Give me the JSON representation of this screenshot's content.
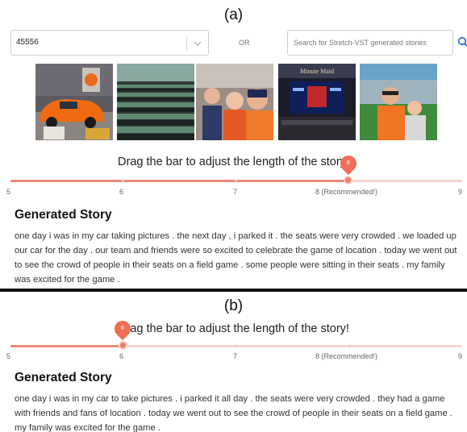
{
  "panels": {
    "a": {
      "label": "(a)"
    },
    "b": {
      "label": "(b)"
    }
  },
  "controls": {
    "story_select": {
      "value": "45556"
    },
    "or_label": "OR",
    "search": {
      "placeholder": "Search for Stretch-VST generated stories",
      "icon": "search-icon"
    }
  },
  "photos": [
    {
      "description": "orange-car-icon"
    },
    {
      "description": "stadium-seats-icon"
    },
    {
      "description": "fans-selfie-icon"
    },
    {
      "description": "scoreboard-icon"
    },
    {
      "description": "ballpark-field-icon"
    }
  ],
  "slider_a": {
    "caption": "Drag the bar to adjust the length of the story!",
    "value": "8",
    "min": 5,
    "max": 9,
    "marks": [
      "5",
      "6",
      "7",
      "8 (Recommended!)",
      "9"
    ]
  },
  "slider_b": {
    "caption": "Drag the bar to adjust the length of the story!",
    "value": "6",
    "min": 5,
    "max": 9,
    "marks": [
      "5",
      "6",
      "7",
      "8 (Recommended!)",
      "9"
    ]
  },
  "story_a": {
    "heading": "Generated Story",
    "text": "one day i was in my car taking pictures . the next day , i parked it . the seats were very crowded . we loaded up our car for the day . our team and friends were so excited to celebrate the game of location . today we went out to see the crowd of people in their seats on a field game . some people were sitting in their seats . my family was excited for the game ."
  },
  "story_b": {
    "heading": "Generated Story",
    "text": "one day i was in my car to take pictures . i parked it all day . the seats were very crowded . they had a game with friends and fans of location . today we went out to see the crowd of people in their seats on a field game . my family was excited for the game ."
  },
  "colors": {
    "accent": "#ef6e56",
    "track": "#f3d6d0"
  }
}
